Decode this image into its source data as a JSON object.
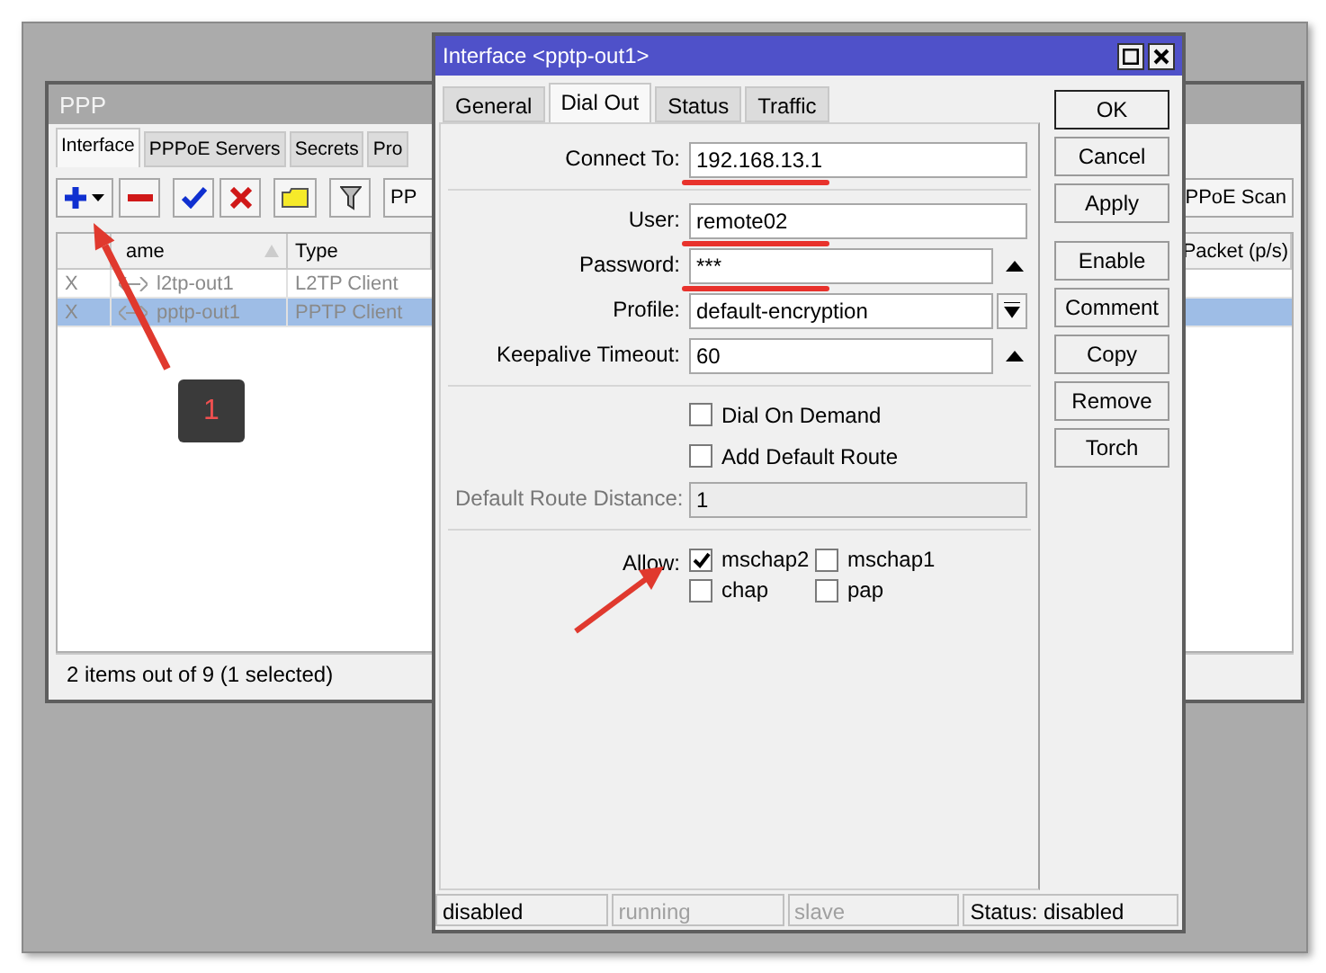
{
  "ppp_window": {
    "title": "PPP",
    "tabs": [
      {
        "label": "Interface",
        "selected": true
      },
      {
        "label": "PPPoE Servers",
        "selected": false
      },
      {
        "label": "Secrets",
        "selected": false
      },
      {
        "label": "Pro",
        "selected": false
      }
    ],
    "toolbar": {
      "left_button": "PP",
      "right_button": "PPoE Scan"
    },
    "columns": [
      "ame",
      "Type",
      "Packet (p/s)"
    ],
    "rows": [
      {
        "flag": "X",
        "name": "l2tp-out1",
        "type": "L2TP Client",
        "selected": false
      },
      {
        "flag": "X",
        "name": "pptp-out1",
        "type": "PPTP Client",
        "selected": true
      }
    ],
    "status": "2 items out of 9 (1 selected)"
  },
  "dialog": {
    "title": "Interface <pptp-out1>",
    "tabs": [
      {
        "label": "General",
        "selected": false
      },
      {
        "label": "Dial Out",
        "selected": true
      },
      {
        "label": "Status",
        "selected": false
      },
      {
        "label": "Traffic",
        "selected": false
      }
    ],
    "fields": [
      {
        "kind": "input",
        "label": "Connect To:",
        "value": "192.168.13.1",
        "disabled": false,
        "underlined": true
      },
      {
        "kind": "divider"
      },
      {
        "kind": "input",
        "label": "User:",
        "value": "remote02",
        "disabled": false,
        "underlined": true
      },
      {
        "kind": "input_up",
        "label": "Password:",
        "value": "***",
        "disabled": false,
        "underlined": true
      },
      {
        "kind": "select",
        "label": "Profile:",
        "value": "default-encryption",
        "disabled": false,
        "underlined": false
      },
      {
        "kind": "input_up",
        "label": "Keepalive Timeout:",
        "value": "60",
        "disabled": false,
        "underlined": false
      },
      {
        "kind": "divider"
      },
      {
        "kind": "checkbox",
        "label": "Dial On Demand",
        "checked": false
      },
      {
        "kind": "checkbox",
        "label": "Add Default Route",
        "checked": false
      },
      {
        "kind": "input",
        "label": "Default Route Distance:",
        "value": "1",
        "disabled": true,
        "underlined": false
      },
      {
        "kind": "divider"
      },
      {
        "kind": "allow",
        "label": "Allow:",
        "options": [
          {
            "label": "mschap2",
            "checked": true
          },
          {
            "label": "mschap1",
            "checked": false
          },
          {
            "label": "chap",
            "checked": false
          },
          {
            "label": "pap",
            "checked": false
          }
        ]
      }
    ],
    "buttons": [
      "OK",
      "Cancel",
      "Apply",
      "Enable",
      "Comment",
      "Copy",
      "Remove",
      "Torch"
    ],
    "status_bar": [
      {
        "text": "disabled",
        "disabled": false
      },
      {
        "text": "running",
        "disabled": true
      },
      {
        "text": "slave",
        "disabled": true
      },
      {
        "text": "Status: disabled",
        "disabled": false
      }
    ]
  },
  "annotation": {
    "badge": "1"
  }
}
